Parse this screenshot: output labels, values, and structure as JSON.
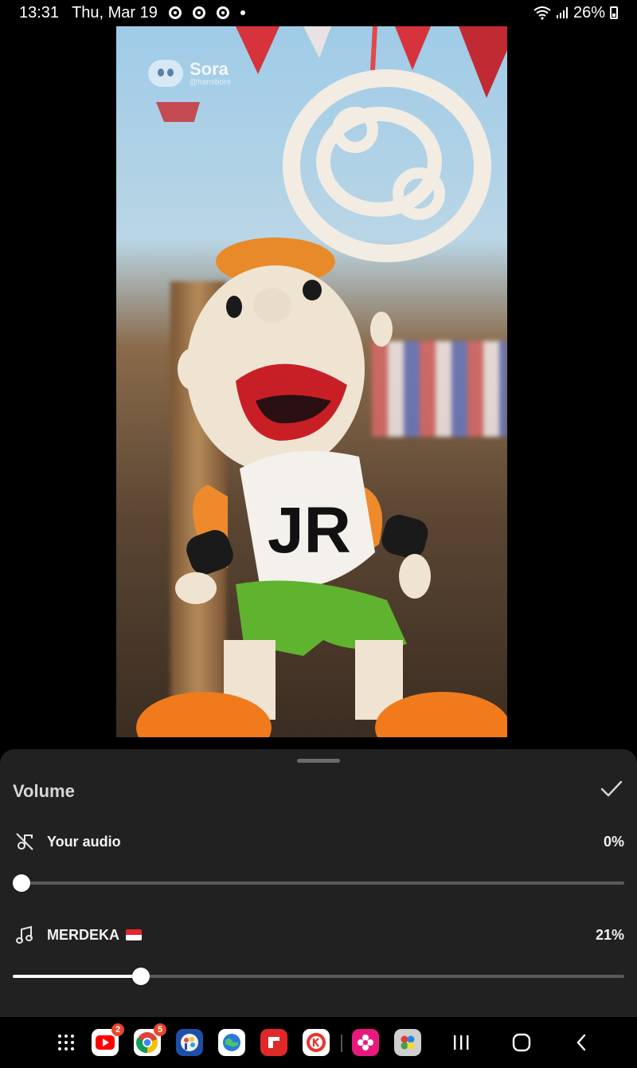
{
  "status_bar": {
    "time": "13:31",
    "date": "Thu, Mar 19",
    "battery": "26%"
  },
  "video": {
    "watermark_brand": "Sora",
    "watermark_handle": "@hansbore",
    "bib_text": "JR"
  },
  "volume_sheet": {
    "title": "Volume",
    "tracks": [
      {
        "label": "Your audio",
        "value": "0%",
        "level": 0.0,
        "icon": "muted-audio-icon"
      },
      {
        "label": "MERDEKA",
        "value": "21%",
        "level": 0.21,
        "icon": "music-note-icon",
        "flag": "indonesia-flag"
      }
    ]
  },
  "taskbar": {
    "apps": [
      {
        "name": "apps-grid",
        "icon": "apps-grid-icon"
      },
      {
        "name": "youtube",
        "icon": "youtube-icon",
        "badge": "2"
      },
      {
        "name": "chrome",
        "icon": "chrome-icon",
        "badge": "5"
      },
      {
        "name": "ibis-paint",
        "icon": "ibis-paint-icon"
      },
      {
        "name": "browser",
        "icon": "globe-icon"
      },
      {
        "name": "flipboard",
        "icon": "flipboard-icon"
      },
      {
        "name": "kinemaster",
        "icon": "kinemaster-icon"
      },
      {
        "name": "gallery",
        "icon": "flower-icon"
      },
      {
        "name": "game-launcher",
        "icon": "game-launcher-icon"
      }
    ],
    "nav": [
      "recents-icon",
      "home-icon",
      "back-icon"
    ]
  },
  "colors": {
    "sheet_bg": "#212121",
    "slider_fill": "#ffffff",
    "slider_track": "#5a5a5a",
    "badge": "#e8452b"
  }
}
